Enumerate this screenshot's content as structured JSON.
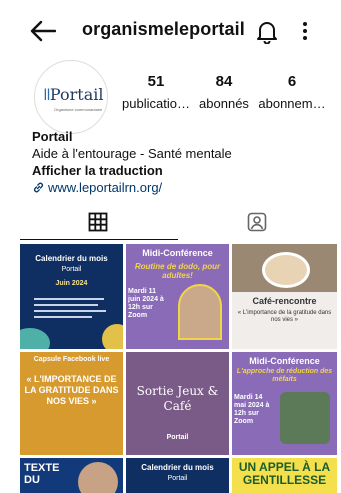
{
  "header": {
    "username": "organismeleportail",
    "back_icon": "back-arrow-icon",
    "bell_icon": "bell-icon",
    "more_icon": "more-vertical-icon"
  },
  "profile": {
    "avatar_text": "Portail",
    "avatar_sub": "Organisme communautaire",
    "stats": [
      {
        "value": "51",
        "label": "publicatio…"
      },
      {
        "value": "84",
        "label": "abonnés"
      },
      {
        "value": "6",
        "label": "abonnem…"
      }
    ],
    "name": "Portail",
    "category": "Aide à l'entourage - Santé mentale",
    "translate": "Afficher la traduction",
    "link": "www.leportailrn.org/"
  },
  "tabs": [
    {
      "name": "posts",
      "icon": "grid-icon",
      "active": true
    },
    {
      "name": "tagged",
      "icon": "tagged-person-icon",
      "active": false
    }
  ],
  "posts": [
    {
      "title": "Calendrier du mois",
      "subtitle": "Juin 2024",
      "brand": "Portail"
    },
    {
      "title": "Midi-Conférence",
      "subtitle": "Routine de dodo, pour adultes!",
      "extra": "Mardi 11 juin 2024 à 12h sur Zoom"
    },
    {
      "title": "Café-rencontre",
      "subtitle": "« L'importance de la gratitude dans nos vies »"
    },
    {
      "title": "Capsule Facebook live",
      "subtitle": "« L'IMPORTANCE DE LA GRATITUDE DANS NOS VIES »"
    },
    {
      "title": "Sortie Jeux & Café",
      "brand": "Portail"
    },
    {
      "title": "Midi-Conférence",
      "subtitle": "L'approche de réduction des méfaits",
      "extra": "Mardi 14 mai 2024 à 12h sur Zoom"
    },
    {
      "title": "TEXTE DU"
    },
    {
      "title": "Calendrier du mois",
      "brand": "Portail"
    },
    {
      "title": "UN APPEL À LA GENTILLESSE"
    }
  ],
  "colors": {
    "link": "#00376b",
    "navy": "#14285a",
    "purple": "#7b4fa8",
    "accent_yellow": "#f2d547"
  }
}
